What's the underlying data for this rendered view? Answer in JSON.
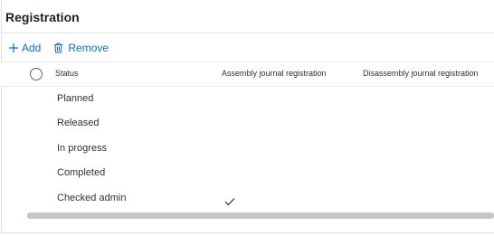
{
  "title": "Registration",
  "toolbar": {
    "add_label": "Add",
    "remove_label": "Remove"
  },
  "grid": {
    "columns": {
      "status": "Status",
      "assembly": "Assembly journal registration",
      "disassembly": "Disassembly journal registration"
    },
    "rows": [
      {
        "status": "Planned",
        "assembly_checked": false
      },
      {
        "status": "Released",
        "assembly_checked": false
      },
      {
        "status": "In progress",
        "assembly_checked": false
      },
      {
        "status": "Completed",
        "assembly_checked": false
      },
      {
        "status": "Checked admin",
        "assembly_checked": true
      }
    ]
  },
  "colors": {
    "accent": "#0f6cbd",
    "border": "#e1dfdd",
    "scrollbar": "#c8c6c4"
  },
  "icons": {
    "add": "plus-icon",
    "remove": "trash-icon",
    "select_all": "radio-circle-icon",
    "checked": "checkmark-icon"
  }
}
